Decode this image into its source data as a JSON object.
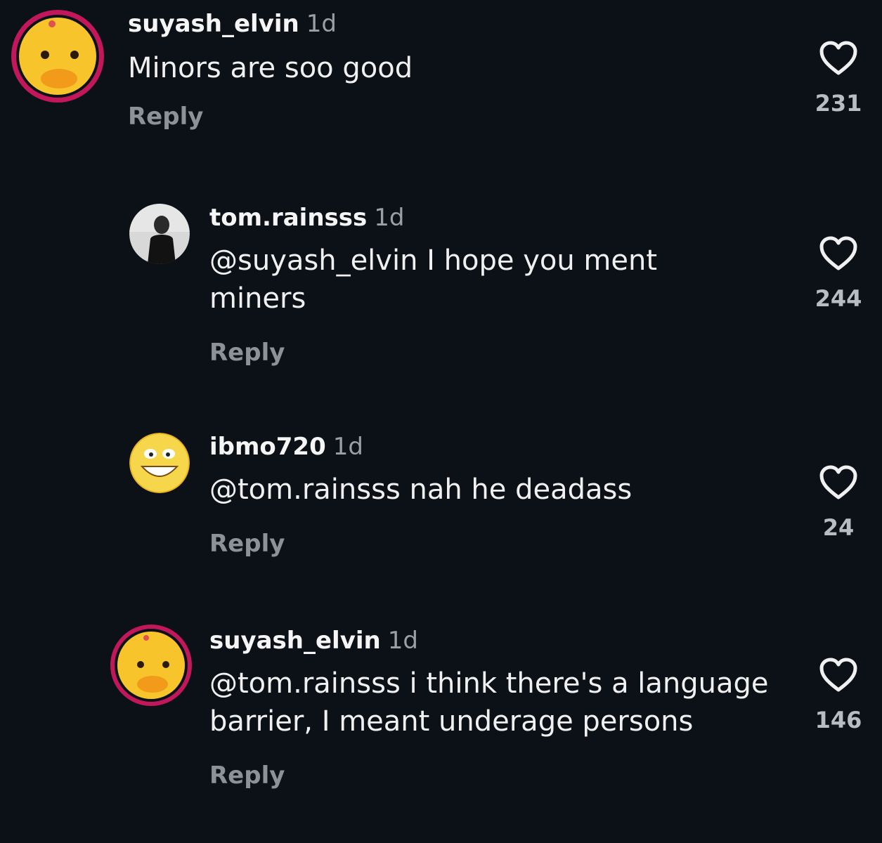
{
  "comments": [
    {
      "username": "suyash_elvin",
      "time": "1d",
      "mention": "",
      "text": "Minors are soo good",
      "reply_label": "Reply",
      "likes": "231",
      "avatar_icon": "duck-avatar"
    },
    {
      "username": "tom.rainsss",
      "time": "1d",
      "mention": "@suyash_elvin",
      "text": " I hope you ment miners",
      "reply_label": "Reply",
      "likes": "244",
      "avatar_icon": "person-photo-avatar"
    },
    {
      "username": "ibmo720",
      "time": "1d",
      "mention": "@tom.rainsss",
      "text": " nah he deadass",
      "reply_label": "Reply",
      "likes": "24",
      "avatar_icon": "grinning-emoji-avatar"
    },
    {
      "username": "suyash_elvin",
      "time": "1d",
      "mention": "@tom.rainsss",
      "text": " i think there's a language barrier, I meant underage persons",
      "reply_label": "Reply",
      "likes": "146",
      "avatar_icon": "duck-avatar"
    }
  ],
  "colors": {
    "background": "#0c1117",
    "text": "#f0f0f0",
    "muted": "#9aa0a6",
    "story_ring": "#c2185b",
    "duck_yellow": "#f7c52b"
  },
  "icons": {
    "like": "heart-outline-icon"
  }
}
